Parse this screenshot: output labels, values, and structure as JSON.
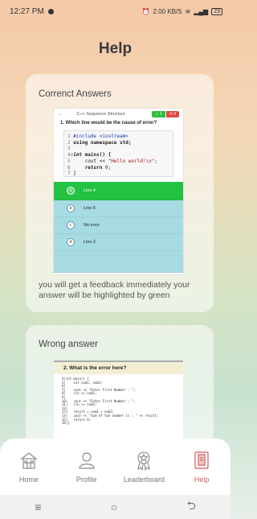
{
  "status_bar": {
    "time": "12:27 PM",
    "network": "2.00 KB/S",
    "battery": "23"
  },
  "page": {
    "title": "Help"
  },
  "correct_card": {
    "title": "Correnct Answers",
    "screenshot": {
      "topbar_title": "C++ Sequence Structure",
      "correct_count": "1",
      "wrong_count": "0",
      "question": "1. Which line would be the cause of error?",
      "options": [
        {
          "letter": "a",
          "label": "Line 4"
        },
        {
          "letter": "b",
          "label": "Line 5"
        },
        {
          "letter": "c",
          "label": "No error"
        },
        {
          "letter": "d",
          "label": "Line 2"
        }
      ]
    },
    "description": "you will get a feedback immediately your answer will be highlighted by green"
  },
  "wrong_card": {
    "title": "Wrong answer",
    "screenshot": {
      "question": "2. What is the error here?",
      "code_lines": [
        "4│int main() {",
        "5│    int num1, num2;",
        "6│",
        "7│    cout << \"Enter First Number : \";",
        "8│    cin >> num1;",
        "9│",
        "10│   cout << \"Enter First Number : \";",
        "11│   cin >> num2;",
        "12│",
        "13│   result = num1 + num2;",
        "14│   cout << \"Sum of two number is : \" << result;",
        "15│   return 0;",
        "16│}"
      ]
    }
  },
  "nav": {
    "items": [
      {
        "label": "Home",
        "icon": "home-icon"
      },
      {
        "label": "Profile",
        "icon": "profile-icon"
      },
      {
        "label": "Leaderboard",
        "icon": "leaderboard-icon"
      },
      {
        "label": "Help",
        "icon": "help-icon"
      }
    ],
    "active": "Help",
    "active_color": "#d25a5a"
  },
  "system_nav": {
    "menu": "≡",
    "home": "○",
    "back": "⮌"
  }
}
